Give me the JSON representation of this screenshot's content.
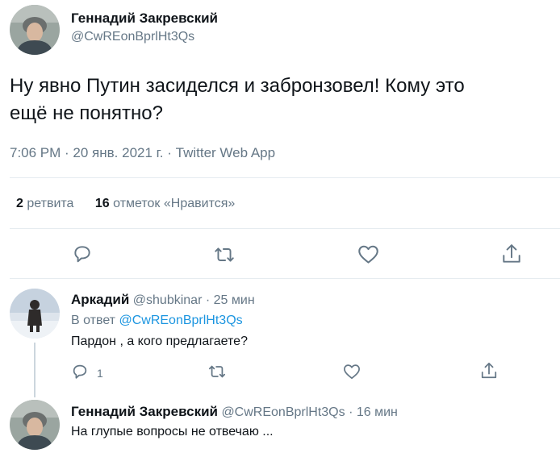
{
  "main_tweet": {
    "author_name": "Геннадий Закревский",
    "author_handle": "@CwREonBprlHt3Qs",
    "text_line1": "Ну явно Путин засиделся и забронзовел! Кому это",
    "text_line2": "ещё не понятно?",
    "meta": "7:06 PM · 20 янв. 2021 г. · Twitter Web App",
    "retweets_count": "2",
    "retweets_label": "ретвита",
    "likes_count": "16",
    "likes_label": "отметок «Нравится»"
  },
  "replies": [
    {
      "author_name": "Аркадий",
      "author_handle": "@shubkinar",
      "time": "· 25 мин",
      "reply_prefix": "В ответ",
      "reply_to": "@CwREonBprlHt3Qs",
      "text": "Пардон , а кого предлагаете?",
      "reply_count": "1"
    },
    {
      "author_name": "Геннадий Закревский",
      "author_handle": "@CwREonBprlHt3Qs",
      "time": "· 16 мин",
      "text": "На глупые вопросы не отвечаю ..."
    }
  ],
  "icons": {
    "reply": "reply-icon",
    "retweet": "retweet-icon",
    "like": "heart-icon",
    "share": "share-icon"
  },
  "colors": {
    "text": "#0f1419",
    "muted": "#657786",
    "link": "#1b95e0",
    "divider": "#e6ecf0"
  }
}
